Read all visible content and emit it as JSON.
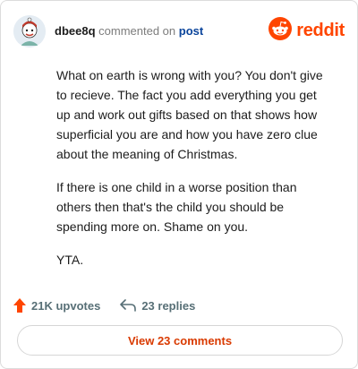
{
  "header": {
    "username": "dbee8q",
    "verb": "commented on",
    "target": "post",
    "brand_word": "reddit",
    "avatar_icon": "snoo-avatar-icon",
    "brand_icon": "reddit-logo-icon"
  },
  "comment": {
    "paragraphs": [
      "What on earth is wrong with you? You don't give to recieve. The fact you add everything you get up and work out gifts based on that shows how superficial you are and how you have zero clue about the meaning of Christmas.",
      "If there is one child in a worse position than others then that's the child you should be spending more on. Shame on you.",
      "YTA."
    ]
  },
  "stats": {
    "upvotes": "21K upvotes",
    "replies": "23 replies",
    "upvote_icon": "upvote-arrow-icon",
    "reply_icon": "reply-arrow-icon"
  },
  "actions": {
    "view_comments": "View 23 comments"
  },
  "colors": {
    "brand": "#ff4500",
    "link": "#0a449b",
    "muted": "#576f76",
    "button_text": "#d93a00"
  }
}
